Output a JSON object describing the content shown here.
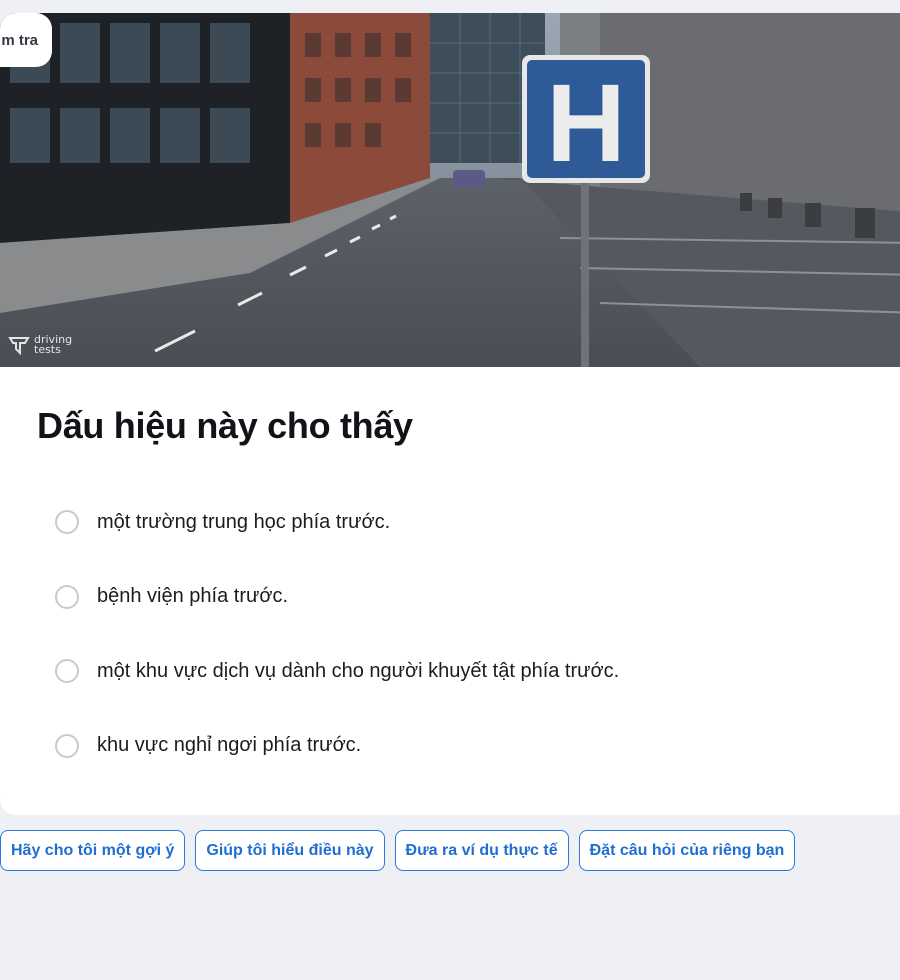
{
  "header": {
    "badge_label": "m tra"
  },
  "image": {
    "sign_letter": "H",
    "watermark_line1": "driving",
    "watermark_line2": "tests",
    "sign_color": "#2e5b98"
  },
  "question": {
    "title": "Dấu hiệu này cho thấy",
    "options": [
      {
        "label": "một trường trung học phía trước."
      },
      {
        "label": "bệnh viện phía trước."
      },
      {
        "label": "một khu vực dịch vụ dành cho người khuyết tật phía trước."
      },
      {
        "label": "khu vực nghỉ ngơi phía trước."
      }
    ]
  },
  "suggestions": [
    {
      "label": "Hãy cho tôi một gợi ý"
    },
    {
      "label": "Giúp tôi hiểu điều này"
    },
    {
      "label": "Đưa ra ví dụ thực tế"
    },
    {
      "label": "Đặt câu hỏi của riêng bạn"
    }
  ],
  "colors": {
    "accent": "#1f6fd1",
    "background": "#eff0f5",
    "radio_border": "#c7c9d3"
  }
}
